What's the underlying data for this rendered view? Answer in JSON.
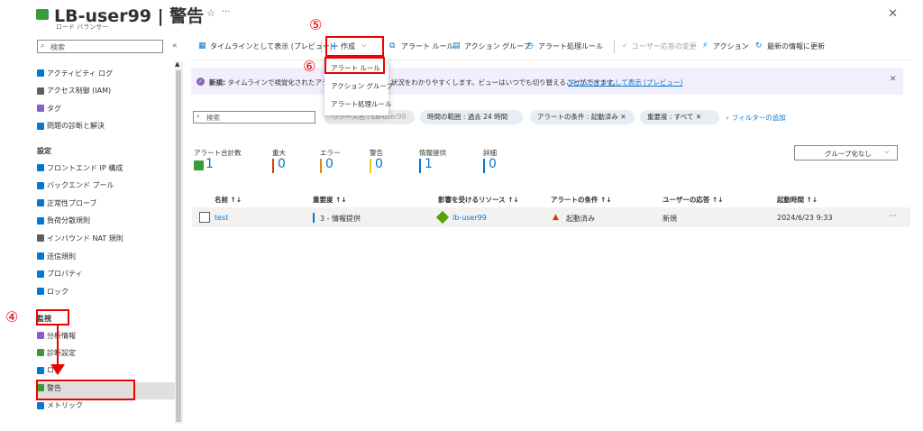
{
  "header": {
    "title": "LB-user99 | 警告",
    "subtitle": "ロード バランサー",
    "pin": "⟡",
    "star": "☆",
    "more": "···",
    "close": "✕"
  },
  "sidebar": {
    "search_placeholder": "検索",
    "collapse": "«",
    "items_top": [
      {
        "label": "アクティビティ ログ",
        "icon": "activity-log-icon",
        "color": "#0078d4"
      },
      {
        "label": "アクセス制御 (IAM)",
        "icon": "iam-icon",
        "color": "#605e5c"
      },
      {
        "label": "タグ",
        "icon": "tag-icon",
        "color": "#8661c5"
      },
      {
        "label": "問題の診断と解決",
        "icon": "diagnose-icon",
        "color": "#0078d4"
      }
    ],
    "section_settings": "設定",
    "items_settings": [
      {
        "label": "フロントエンド IP 構成",
        "icon": "frontend-ip-icon",
        "color": "#0078d4"
      },
      {
        "label": "バックエンド プール",
        "icon": "backend-pool-icon",
        "color": "#0078d4"
      },
      {
        "label": "正常性プローブ",
        "icon": "health-probe-icon",
        "color": "#0078d4"
      },
      {
        "label": "負荷分散規則",
        "icon": "lb-rules-icon",
        "color": "#0078d4"
      },
      {
        "label": "インバウンド NAT 規則",
        "icon": "nat-rules-icon",
        "color": "#605e5c"
      },
      {
        "label": "送信規則",
        "icon": "outbound-rules-icon",
        "color": "#0078d4"
      },
      {
        "label": "プロパティ",
        "icon": "properties-icon",
        "color": "#0078d4"
      },
      {
        "label": "ロック",
        "icon": "lock-icon",
        "color": "#0078d4"
      }
    ],
    "section_monitoring": "監視",
    "items_monitoring": [
      {
        "label": "分析情報",
        "icon": "insights-icon",
        "color": "#8661c5"
      },
      {
        "label": "診断設定",
        "icon": "diagnostic-settings-icon",
        "color": "#3a9b3a"
      },
      {
        "label": "ログ",
        "icon": "logs-icon",
        "color": "#0078d4"
      },
      {
        "label": "警告",
        "icon": "alerts-icon",
        "color": "#3a9b3a"
      },
      {
        "label": "メトリック",
        "icon": "metrics-icon",
        "color": "#0078d4"
      }
    ]
  },
  "toolbar": {
    "timeline": "タイムラインとして表示 (プレビュー)",
    "create": "作成",
    "alert_rules": "アラート ルール",
    "action_groups": "アクション グループ",
    "processing_rules": "アラート処理ルール",
    "change_response": "ユーザー応答の変更",
    "actions": "アクション",
    "refresh": "最新の情報に更新"
  },
  "dropdown": {
    "items": [
      "アラート ルール",
      "アクション グループ",
      "アラート処理ルール"
    ]
  },
  "banner": {
    "bold": "新規:",
    "text": "タイムラインで視覚化されたアラー",
    "text2": "状況をわかりやすくします。ビューはいつでも切り替えることができます。",
    "link": "タイムラインとして表示 (プレビュー)",
    "close": "✕"
  },
  "filters": {
    "search_placeholder": "検索",
    "resource": "リソース名 : LB-user99",
    "time": "時間の範囲 : 過去 24 時間",
    "condition": "アラートの条件 : 起動済み",
    "severity": "重要度 : すべて",
    "add": "フィルターの追加"
  },
  "counts": [
    {
      "label": "アラート合計数",
      "value": "1",
      "color": "#3a9b3a"
    },
    {
      "label": "重大",
      "value": "0",
      "color": "#d83b01"
    },
    {
      "label": "エラー",
      "value": "0",
      "color": "#e8801c"
    },
    {
      "label": "警告",
      "value": "0",
      "color": "#f2c811"
    },
    {
      "label": "情報提供",
      "value": "1",
      "color": "#0078d4"
    },
    {
      "label": "詳細",
      "value": "0",
      "color": "#0078d4"
    }
  ],
  "grouping": "グループ化なし",
  "table": {
    "headers": [
      "名前 ↑↓",
      "重要度 ↑↓",
      "影響を受けるリソース ↑↓",
      "アラートの条件 ↑↓",
      "ユーザーの応答 ↑↓",
      "起動時間 ↑↓"
    ],
    "row": {
      "name": "test",
      "severity": "3 - 情報提供",
      "resource": "lb-user99",
      "condition": "起動済み",
      "response": "新規",
      "time": "2024/6/23 9:33"
    }
  },
  "annotations": {
    "step4": "④",
    "step5": "⑤",
    "step6": "⑥"
  }
}
